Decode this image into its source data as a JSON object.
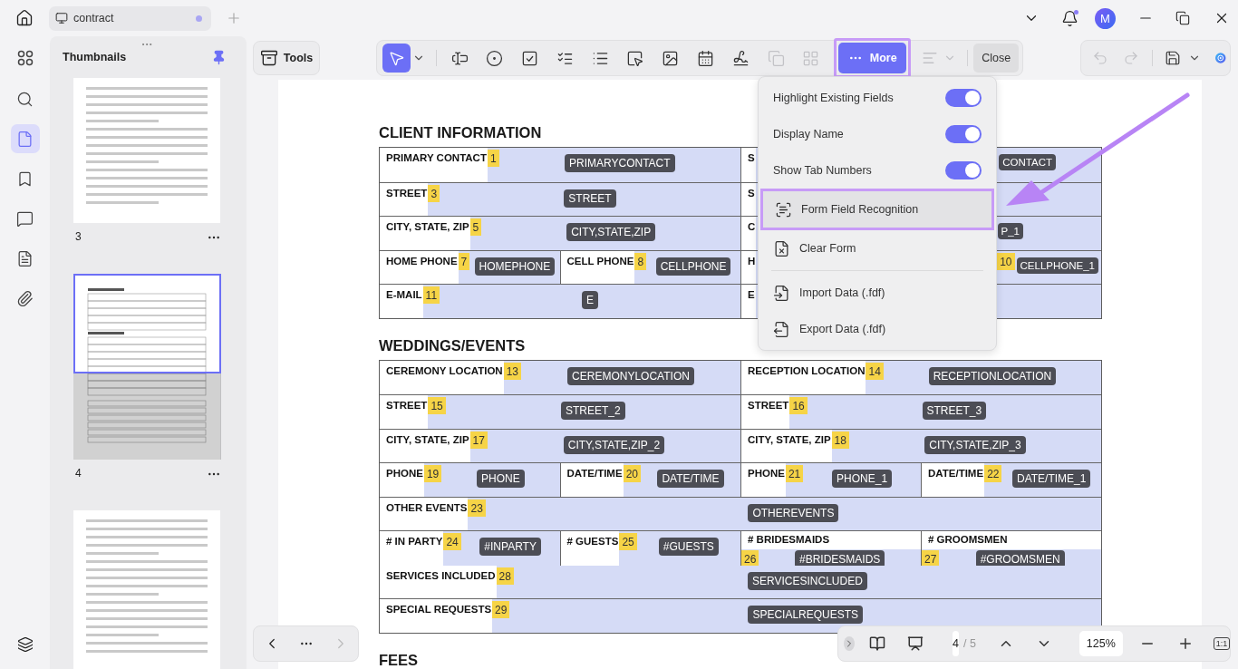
{
  "title_bar": {
    "tab": {
      "title": "contract",
      "modified": true
    },
    "notifications": true,
    "avatar": "M"
  },
  "rail": [
    {
      "selected": false
    },
    {
      "selected": false
    },
    {
      "selected": true
    },
    {
      "selected": false
    },
    {
      "selected": false
    },
    {
      "selected": false
    },
    {
      "selected": false
    }
  ],
  "thumbnails": {
    "title": "Thumbnails",
    "pinned": true,
    "pages": [
      {
        "kind": "text",
        "label": "3",
        "selected": false
      },
      {
        "kind": "form",
        "label": "4",
        "selected": true
      },
      {
        "kind": "text",
        "selected": false
      }
    ]
  },
  "tools_button": "Tools",
  "toolbar": {
    "tools": [
      {
        "kind": "dropdown",
        "selected": true,
        "disabled": false
      },
      {
        "kind": "button",
        "selected": false,
        "disabled": false
      },
      {
        "kind": "button",
        "selected": false,
        "disabled": false
      },
      {
        "kind": "button",
        "selected": false,
        "disabled": false
      },
      {
        "kind": "button",
        "selected": false,
        "disabled": false
      },
      {
        "kind": "button",
        "selected": false,
        "disabled": false
      },
      {
        "kind": "button",
        "selected": false,
        "disabled": false
      },
      {
        "kind": "button",
        "selected": false,
        "disabled": false
      },
      {
        "kind": "button",
        "selected": false,
        "disabled": false
      },
      {
        "kind": "button",
        "selected": false,
        "disabled": false
      },
      {
        "kind": "button",
        "selected": false,
        "disabled": true
      },
      {
        "kind": "button",
        "selected": false,
        "disabled": true
      }
    ],
    "more": {
      "label": "More",
      "highlighted": true
    },
    "align": {
      "disabled": true
    },
    "close": "Close"
  },
  "right_toolbar": [
    {
      "disabled": true
    },
    {
      "disabled": true
    },
    {
      "disabled": false
    }
  ],
  "more_menu": {
    "sections": [
      {
        "items": [
          {
            "kind": "toggle",
            "label": "Highlight Existing Fields",
            "on": true
          },
          {
            "kind": "toggle",
            "label": "Display Name",
            "on": true
          },
          {
            "kind": "toggle",
            "label": "Show Tab Numbers",
            "on": true
          },
          {
            "kind": "action",
            "label": "Form Field Recognition",
            "highlighted": true
          },
          {
            "kind": "action",
            "label": "Clear Form",
            "highlighted": false
          }
        ]
      },
      {
        "items": [
          {
            "kind": "action",
            "label": "Import Data (.fdf)",
            "highlighted": false
          },
          {
            "kind": "action",
            "label": "Export Data (.fdf)",
            "highlighted": false
          }
        ]
      }
    ]
  },
  "document": {
    "sections": [
      {
        "title": "CLIENT INFORMATION",
        "rows": [
          {
            "halves": [
              {
                "cells": [
                  {
                    "kind": "inline",
                    "label": "PRIMARY CONTACT",
                    "tab_number": "1",
                    "field_name": "PRIMARYCONTACT"
                  }
                ]
              },
              {
                "cells": [
                  {
                    "kind": "covered",
                    "label": "S",
                    "field_name": "CONTACT"
                  }
                ]
              }
            ]
          },
          {
            "halves": [
              {
                "cells": [
                  {
                    "kind": "inline",
                    "label": "STREET",
                    "tab_number": "3",
                    "field_name": "STREET"
                  }
                ]
              },
              {
                "cells": [
                  {
                    "kind": "covered",
                    "label": "S"
                  }
                ]
              }
            ]
          },
          {
            "halves": [
              {
                "cells": [
                  {
                    "kind": "inline",
                    "label": "CITY, STATE, ZIP",
                    "tab_number": "5",
                    "field_name": "CITY,STATE,ZIP"
                  }
                ]
              },
              {
                "cells": [
                  {
                    "kind": "covered",
                    "label": "C",
                    "field_name": "P_1"
                  }
                ]
              }
            ]
          },
          {
            "halves": [
              {
                "cells": [
                  {
                    "kind": "inline",
                    "label": "HOME PHONE",
                    "tab_number": "7",
                    "field_name": "HOMEPHONE"
                  },
                  {
                    "kind": "inline",
                    "label": "CELL PHONE",
                    "tab_number": "8",
                    "field_name": "CELLPHONE"
                  }
                ]
              },
              {
                "cells": [
                  {
                    "kind": "covered",
                    "label": "H",
                    "tab_number": "10",
                    "field_name": "CELLPHONE_1"
                  }
                ]
              }
            ]
          },
          {
            "halves": [
              {
                "cells": [
                  {
                    "kind": "inline",
                    "label": "E-MAIL",
                    "tab_number": "11",
                    "field_name": "E"
                  }
                ]
              },
              {
                "cells": [
                  {
                    "kind": "covered",
                    "label": "E"
                  }
                ]
              }
            ]
          }
        ]
      },
      {
        "title": "WEDDINGS/EVENTS",
        "rows": [
          {
            "halves": [
              {
                "cells": [
                  {
                    "kind": "inline",
                    "label": "CEREMONY LOCATION",
                    "tab_number": "13",
                    "field_name": "CEREMONYLOCATION"
                  }
                ]
              },
              {
                "cells": [
                  {
                    "kind": "inline",
                    "label": "RECEPTION LOCATION",
                    "tab_number": "14",
                    "field_name": "RECEPTIONLOCATION"
                  }
                ]
              }
            ]
          },
          {
            "halves": [
              {
                "cells": [
                  {
                    "kind": "inline",
                    "label": "STREET",
                    "tab_number": "15",
                    "field_name": "STREET_2"
                  }
                ]
              },
              {
                "cells": [
                  {
                    "kind": "inline",
                    "label": "STREET",
                    "tab_number": "16",
                    "field_name": "STREET_3"
                  }
                ]
              }
            ]
          },
          {
            "halves": [
              {
                "cells": [
                  {
                    "kind": "inline",
                    "label": "CITY, STATE, ZIP",
                    "tab_number": "17",
                    "field_name": "CITY,STATE,ZIP_2"
                  }
                ]
              },
              {
                "cells": [
                  {
                    "kind": "inline",
                    "label": "CITY, STATE, ZIP",
                    "tab_number": "18",
                    "field_name": "CITY,STATE,ZIP_3"
                  }
                ]
              }
            ]
          },
          {
            "halves": [
              {
                "cells": [
                  {
                    "kind": "inline",
                    "label": "PHONE",
                    "tab_number": "19",
                    "field_name": "PHONE"
                  },
                  {
                    "kind": "inline",
                    "label": "DATE/TIME",
                    "tab_number": "20",
                    "field_name": "DATE/TIME"
                  }
                ]
              },
              {
                "cells": [
                  {
                    "kind": "inline",
                    "label": "PHONE",
                    "tab_number": "21",
                    "field_name": "PHONE_1"
                  },
                  {
                    "kind": "inline",
                    "label": "DATE/TIME",
                    "tab_number": "22",
                    "field_name": "DATE/TIME_1"
                  }
                ]
              }
            ]
          },
          {
            "halves": [
              {
                "cells": [
                  {
                    "kind": "inline",
                    "label": "OTHER EVENTS",
                    "tab_number": "23",
                    "field_name": "OTHEREVENTS"
                  }
                ]
              }
            ]
          },
          {
            "halves": [
              {
                "cells": [
                  {
                    "kind": "inline",
                    "label": "# IN PARTY",
                    "tab_number": "24",
                    "field_name": "#INPARTY"
                  },
                  {
                    "kind": "inline",
                    "label": "# GUESTS",
                    "tab_number": "25",
                    "field_name": "#GUESTS"
                  }
                ]
              },
              {
                "cells": [
                  {
                    "kind": "stacked",
                    "label": "# BRIDESMAIDS",
                    "tab_number": "26",
                    "field_name": "#BRIDESMAIDS"
                  },
                  {
                    "kind": "stacked",
                    "label": "# GROOMSMEN",
                    "tab_number": "27",
                    "field_name": "#GROOMSMEN"
                  }
                ]
              }
            ]
          },
          {
            "halves": [
              {
                "cells": [
                  {
                    "kind": "inline",
                    "label": "SERVICES INCLUDED",
                    "tab_number": "28",
                    "field_name": "SERVICESINCLUDED"
                  }
                ]
              }
            ]
          },
          {
            "halves": [
              {
                "cells": [
                  {
                    "kind": "inline",
                    "label": "SPECIAL REQUESTS",
                    "tab_number": "29",
                    "field_name": "SPECIALREQUESTS"
                  }
                ]
              }
            ]
          }
        ]
      },
      {
        "title": "FEES"
      }
    ]
  },
  "page_nav": {
    "current": "4",
    "total": "/ 5",
    "zoom": "125%",
    "actual_size": "1:1"
  }
}
